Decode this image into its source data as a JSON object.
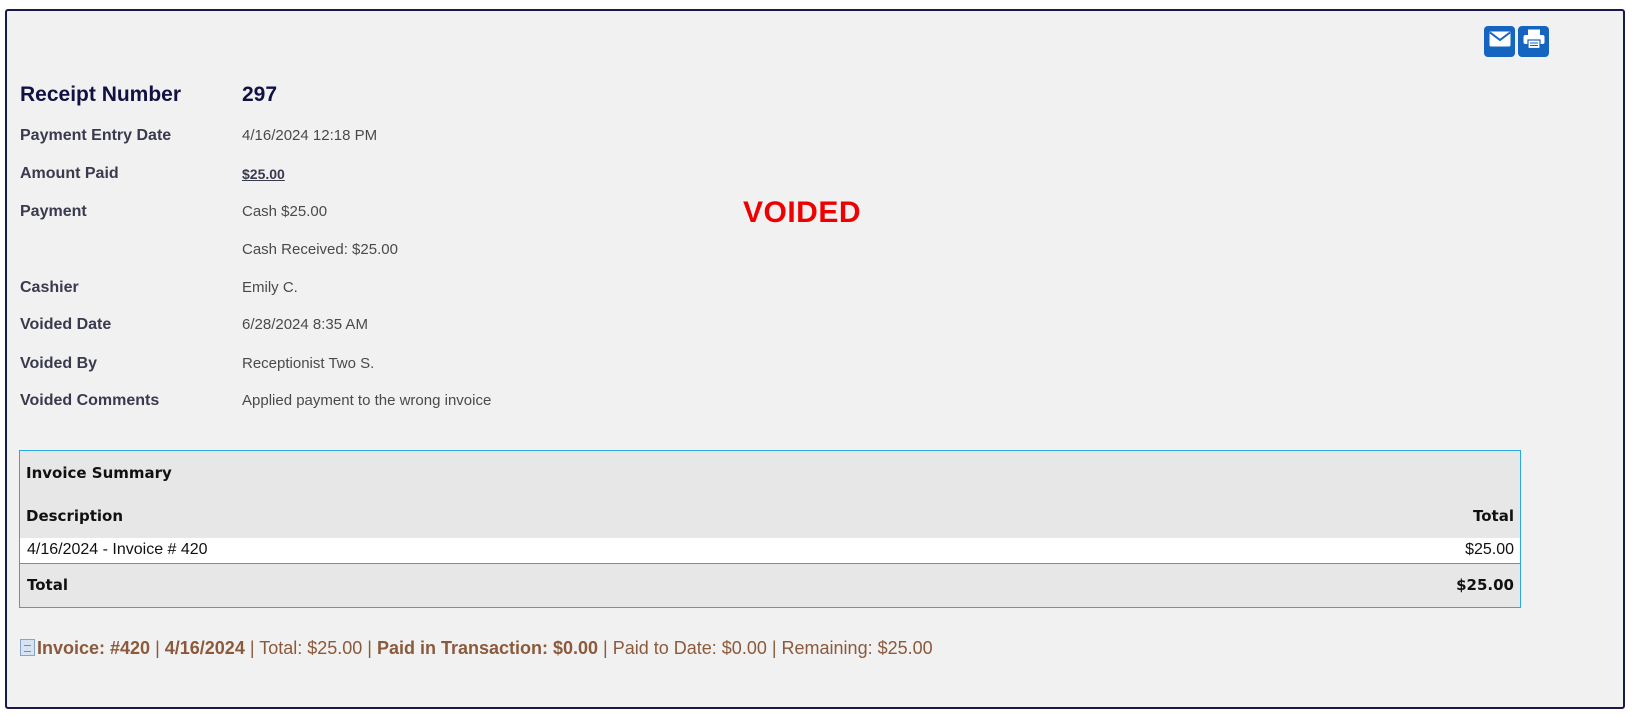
{
  "toolbar": {
    "email_icon": "envelope-icon",
    "print_icon": "printer-icon",
    "accent": "#1565c0"
  },
  "receipt": {
    "number_label": "Receipt Number",
    "number_value": "297",
    "entry_date_label": "Payment Entry Date",
    "entry_date_value": "4/16/2024 12:18 PM",
    "amount_label": "Amount Paid",
    "amount_value": "$25.00",
    "payment_label": "Payment",
    "payment_value": "Cash $25.00",
    "cash_received": "Cash Received: $25.00",
    "cashier_label": "Cashier",
    "cashier_value": "Emily C.",
    "voided_date_label": "Voided Date",
    "voided_date_value": "6/28/2024 8:35 AM",
    "voided_by_label": "Voided By",
    "voided_by_value": "Receptionist Two S.",
    "voided_comments_label": "Voided Comments",
    "voided_comments_value": "Applied payment to the wrong invoice"
  },
  "status": {
    "voided": "VOIDED",
    "color": "#ee0000"
  },
  "invoice_summary": {
    "title": "Invoice Summary",
    "col_description": "Description",
    "col_total": "Total",
    "rows": [
      {
        "description": "4/16/2024 - Invoice # 420",
        "total": "$25.00"
      }
    ],
    "total_label": "Total",
    "total_value": "$25.00"
  },
  "invoice_line": {
    "icon": "document-icon",
    "invoice": "Invoice: #420",
    "sep1": " | ",
    "date": "4/16/2024",
    "sep2": " | ",
    "total": "Total: $25.00",
    "sep3": " | ",
    "paid_in_transaction": "Paid in Transaction: $0.00",
    "sep4": " | ",
    "paid_to_date": "Paid to Date: $0.00",
    "sep5": " | ",
    "remaining": "Remaining: $25.00"
  }
}
